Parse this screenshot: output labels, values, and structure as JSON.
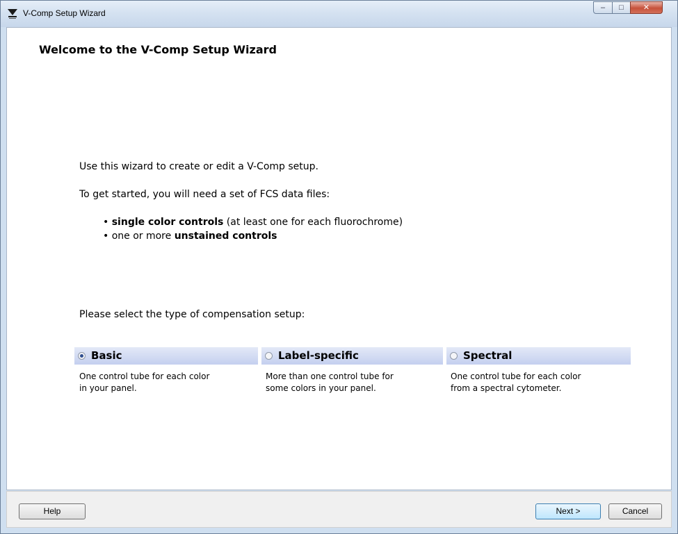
{
  "window": {
    "title": "V-Comp Setup Wizard",
    "controls": {
      "minimize": "–",
      "maximize": "□",
      "close": "✕"
    }
  },
  "content": {
    "heading": "Welcome to the V-Comp Setup Wizard",
    "intro": "Use this wizard to create or edit a V-Comp setup.",
    "requirement": "To get started, you will need a set of FCS data files:",
    "bullets": [
      {
        "prefix": "• ",
        "bold": "single color controls",
        "rest": " (at least one for each fluorochrome)"
      },
      {
        "prefix": "• one or more ",
        "bold": "unstained controls",
        "rest": ""
      }
    ],
    "select_prompt": "Please select the type of compensation setup:",
    "options": [
      {
        "label": "Basic",
        "selected": true,
        "desc_line1": "One control tube for each color",
        "desc_line2": "in your panel."
      },
      {
        "label": "Label-specific",
        "selected": false,
        "desc_line1": "More than one control tube for",
        "desc_line2": "some colors in your panel."
      },
      {
        "label": "Spectral",
        "selected": false,
        "desc_line1": "One control tube for each color",
        "desc_line2": "from a spectral cytometer."
      }
    ]
  },
  "footer": {
    "help": "Help",
    "next": "Next >",
    "cancel": "Cancel"
  },
  "colors": {
    "option_header_top": "#e3e9f7",
    "option_header_bottom": "#c4cfef",
    "default_button": "#bee6fd"
  }
}
